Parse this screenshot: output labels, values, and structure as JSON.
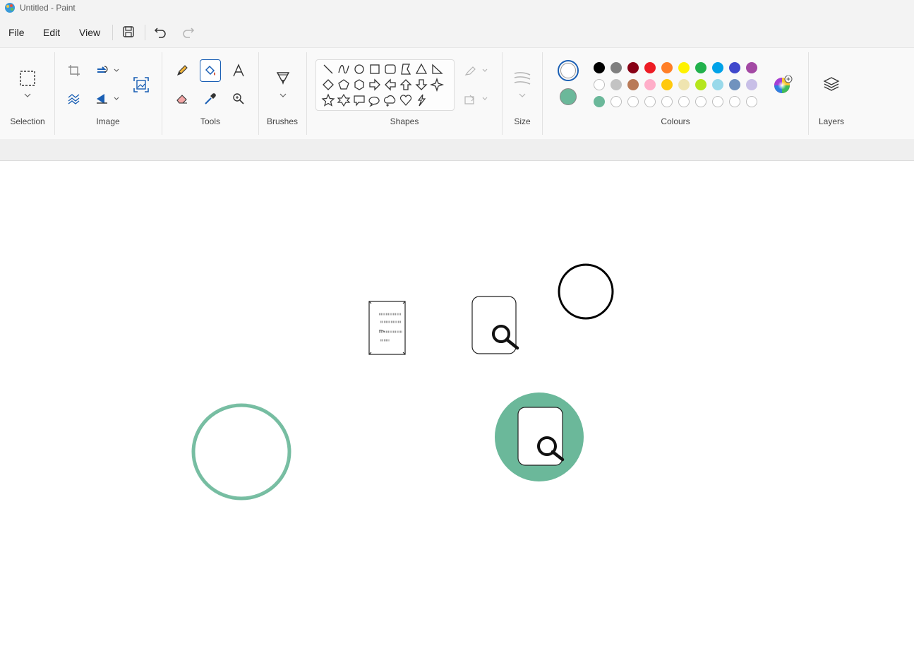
{
  "window": {
    "title": "Untitled - Paint"
  },
  "menu": {
    "file": "File",
    "edit": "Edit",
    "view": "View"
  },
  "ribbon": {
    "selection_label": "Selection",
    "image_label": "Image",
    "tools_label": "Tools",
    "brushes_label": "Brushes",
    "shapes_label": "Shapes",
    "size_label": "Size",
    "colours_label": "Colours",
    "layers_label": "Layers"
  },
  "colours": {
    "primary": "#ffffff",
    "secondary": "#6bb89a",
    "palette_row1": [
      "#000000",
      "#7f7f7f",
      "#880015",
      "#ed1c24",
      "#ff7f27",
      "#fff200",
      "#22b14c",
      "#00a2e8",
      "#3f48cc",
      "#a349a4"
    ],
    "palette_row2": [
      "#ffffff",
      "#c3c3c3",
      "#b97a57",
      "#ffaec9",
      "#ffc90e",
      "#efe4b0",
      "#b5e61d",
      "#99d9ea",
      "#7092be",
      "#c8bfe7"
    ],
    "custom_row": [
      "#6bb89a"
    ]
  },
  "canvas_theme": {
    "accent_green": "#6bb89a"
  }
}
